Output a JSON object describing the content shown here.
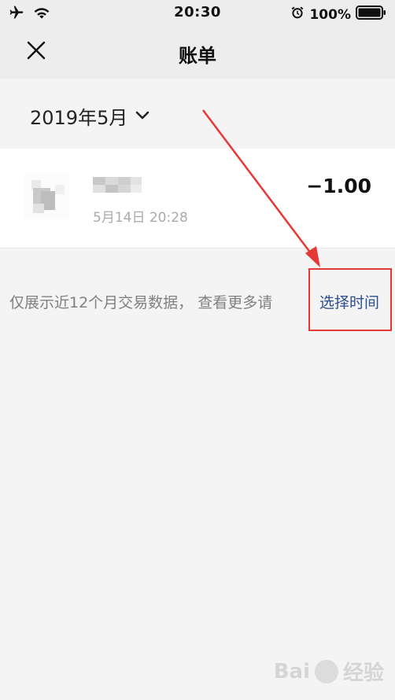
{
  "status_bar": {
    "time": "20:30",
    "battery_text": "100%",
    "icons": [
      "airplane-icon",
      "wifi-icon",
      "alarm-icon",
      "battery-icon"
    ]
  },
  "nav": {
    "title": "账单",
    "close_icon": "close-icon"
  },
  "month_selector": {
    "label": "2019年5月",
    "icon": "chevron-down-icon"
  },
  "transactions": [
    {
      "time": "5月14日 20:28",
      "amount": "−1.00"
    }
  ],
  "notice": {
    "text": "仅展示近12个月交易数据， 查看更多请",
    "link_text": "选择时间"
  },
  "colors": {
    "header_bg": "#ededed",
    "page_bg": "#f4f4f4",
    "card_bg": "#ffffff",
    "link": "#2b4e8e",
    "annotation_red": "#e53935"
  }
}
